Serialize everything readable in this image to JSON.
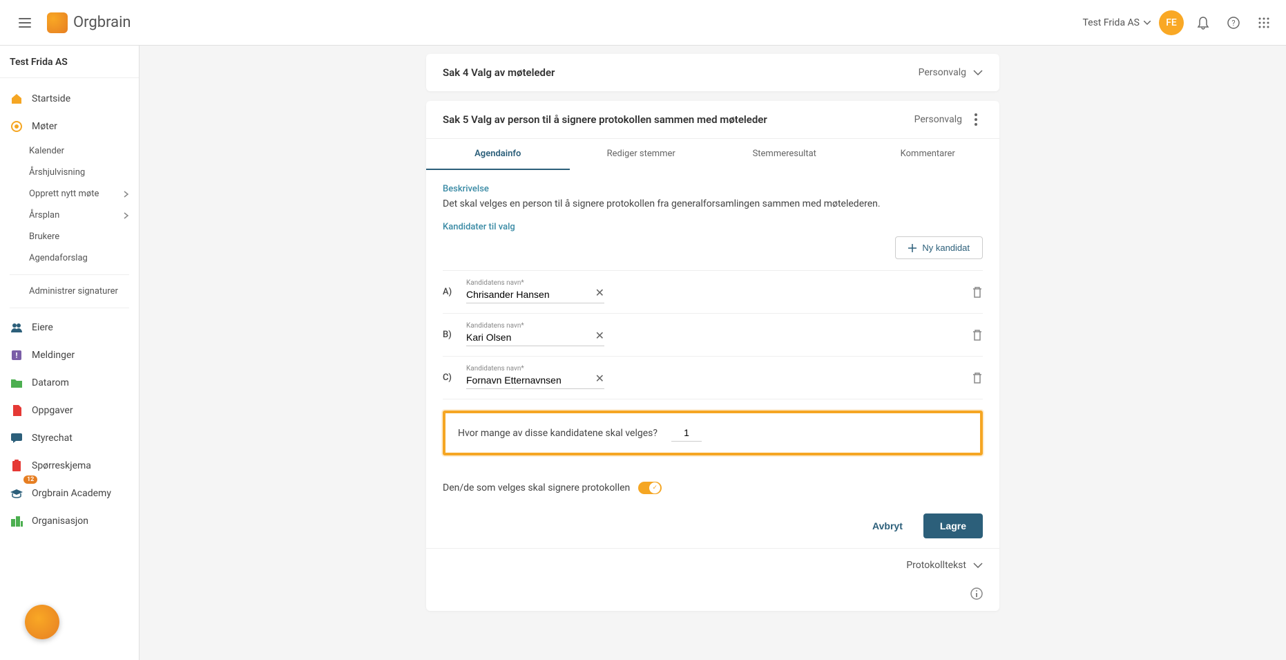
{
  "header": {
    "org_dropdown": "Test Frida AS",
    "avatar_initials": "FE",
    "logo_text": "Orgbrain"
  },
  "sidebar": {
    "org_name": "Test Frida AS",
    "items": [
      {
        "label": "Startside"
      },
      {
        "label": "Møter"
      },
      {
        "label": "Eiere"
      },
      {
        "label": "Meldinger"
      },
      {
        "label": "Datarom"
      },
      {
        "label": "Oppgaver"
      },
      {
        "label": "Styrechat"
      },
      {
        "label": "Spørreskjema"
      },
      {
        "label": "Orgbrain Academy",
        "badge": "12"
      },
      {
        "label": "Organisasjon"
      }
    ],
    "sub": {
      "kalender": "Kalender",
      "arshjul": "Årshjulvisning",
      "opprett": "Opprett nytt møte",
      "arsplan": "Årsplan",
      "brukere": "Brukere",
      "agenda": "Agendaforslag",
      "signaturer": "Administrer signaturer"
    }
  },
  "card4": {
    "title": "Sak 4 Valg av møteleder",
    "type": "Personvalg"
  },
  "card5": {
    "title": "Sak 5 Valg av person til å signere protokollen sammen med møteleder",
    "type": "Personvalg",
    "tabs": {
      "info": "Agendainfo",
      "rediger": "Rediger stemmer",
      "resultat": "Stemmeresultat",
      "kommentarer": "Kommentarer"
    },
    "beskrivelse_label": "Beskrivelse",
    "beskrivelse_text": "Det skal velges en person til å signere protokollen fra generalforsamlingen sammen med møtelederen.",
    "kandidater_label": "Kandidater til valg",
    "new_candidate": "Ny kandidat",
    "field_label": "Kandidatens navn*",
    "candidates": [
      {
        "letter": "A)",
        "name": "Chrisander Hansen"
      },
      {
        "letter": "B)",
        "name": "Kari Olsen"
      },
      {
        "letter": "C)",
        "name": "Fornavn Etternavnsen"
      }
    ],
    "how_many_label": "Hvor mange av disse kandidatene skal velges?",
    "how_many_value": "1",
    "toggle_label": "Den/de som velges skal signere protokollen",
    "cancel": "Avbryt",
    "save": "Lagre",
    "protokolltekst": "Protokolltekst"
  }
}
